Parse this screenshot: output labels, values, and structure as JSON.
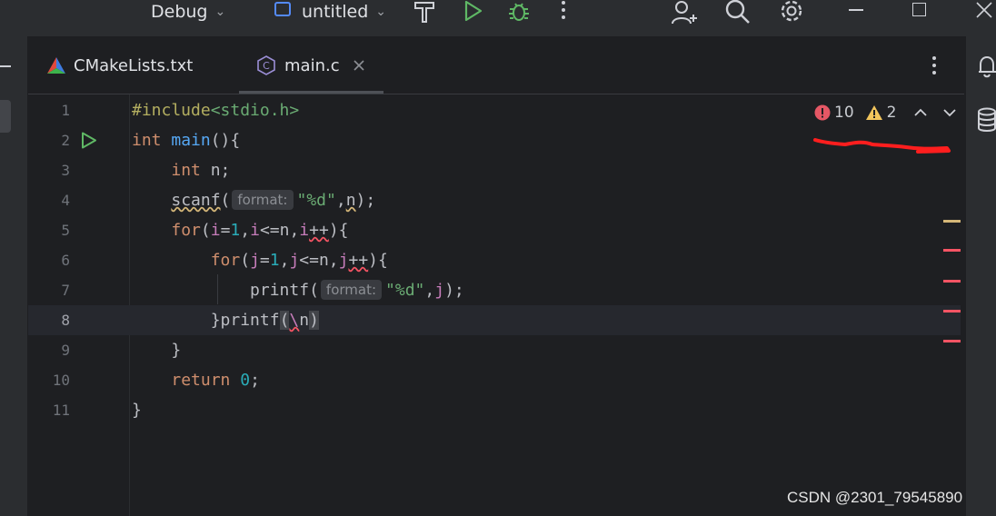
{
  "toolbar": {
    "config_label": "Debug",
    "project_label": "untitled"
  },
  "tabs": [
    {
      "label": "CMakeLists.txt"
    },
    {
      "label": "main.c",
      "icon_letter": "C"
    }
  ],
  "inspections": {
    "errors": "10",
    "warnings": "2"
  },
  "editor": {
    "line_numbers": [
      "1",
      "2",
      "3",
      "4",
      "5",
      "6",
      "7",
      "8",
      "9",
      "10",
      "11"
    ],
    "current_line": "8",
    "hint_label": "format:",
    "tokens": {
      "include": "#include",
      "header": "<stdio.h>",
      "int": "int",
      "main": "main",
      "paren_brace": "(){",
      "decl": " n;",
      "scanf": "scanf",
      "open_paren": "(",
      "fmt_d": "\"%d\"",
      "comma": ",",
      "n": "n",
      "close_semicolon": ");",
      "for": "for",
      "i": "i",
      "j": "j",
      "eq": "=",
      "one": "1",
      "lte_n": "<=n",
      "plusplus": "++",
      "close_brace_open": "){",
      "printf": "printf",
      "close_brace": "}",
      "nl_backslash": "\\",
      "close_paren": ")",
      "return": "return",
      "zero": "0",
      "semicolon": ";"
    }
  },
  "watermark": "CSDN @2301_79545890",
  "colors": {
    "error_marker": "#f75464",
    "warning_marker": "#d5b778",
    "annotation_stroke": "#ff1e1e"
  }
}
